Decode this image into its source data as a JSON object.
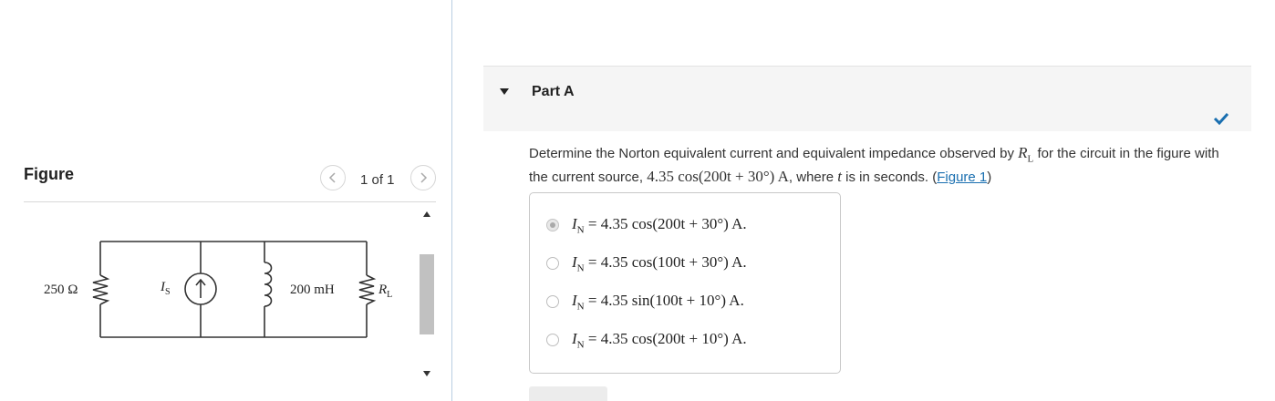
{
  "figure_panel": {
    "title": "Figure",
    "pager_text": "1 of 1",
    "prev_icon": "chevron-left-icon",
    "next_icon": "chevron-right-icon",
    "circuit": {
      "resistor_label": "250 Ω",
      "source_label": "I",
      "source_sub": "S",
      "inductor_label": "200 mH",
      "load_label": "R",
      "load_sub": "L"
    }
  },
  "part": {
    "title": "Part A",
    "status_icon": "checkmark-icon",
    "status_color": "#1a6fb0"
  },
  "question": {
    "text_before": "Determine the Norton equivalent current and equivalent impedance observed by ",
    "rl_symbol": "R",
    "rl_sub": "L",
    "text_middle": " for the circuit in the figure with the current source, ",
    "source_expr": "4.35 cos(200t + 30°) A",
    "text_after": ", where ",
    "t_symbol": "t",
    "text_end": " is in seconds. (",
    "figure_link": "Figure 1",
    "close_paren": ")"
  },
  "options": [
    {
      "prefix": "I",
      "sub": "N",
      "expr": " = 4.35 cos(200t + 30°) A.",
      "selected": true
    },
    {
      "prefix": "I",
      "sub": "N",
      "expr": " = 4.35 cos(100t + 30°) A.",
      "selected": false
    },
    {
      "prefix": "I",
      "sub": "N",
      "expr": " = 4.35 sin(100t + 10°) A.",
      "selected": false
    },
    {
      "prefix": "I",
      "sub": "N",
      "expr": " = 4.35 cos(200t + 10°) A.",
      "selected": false
    }
  ]
}
